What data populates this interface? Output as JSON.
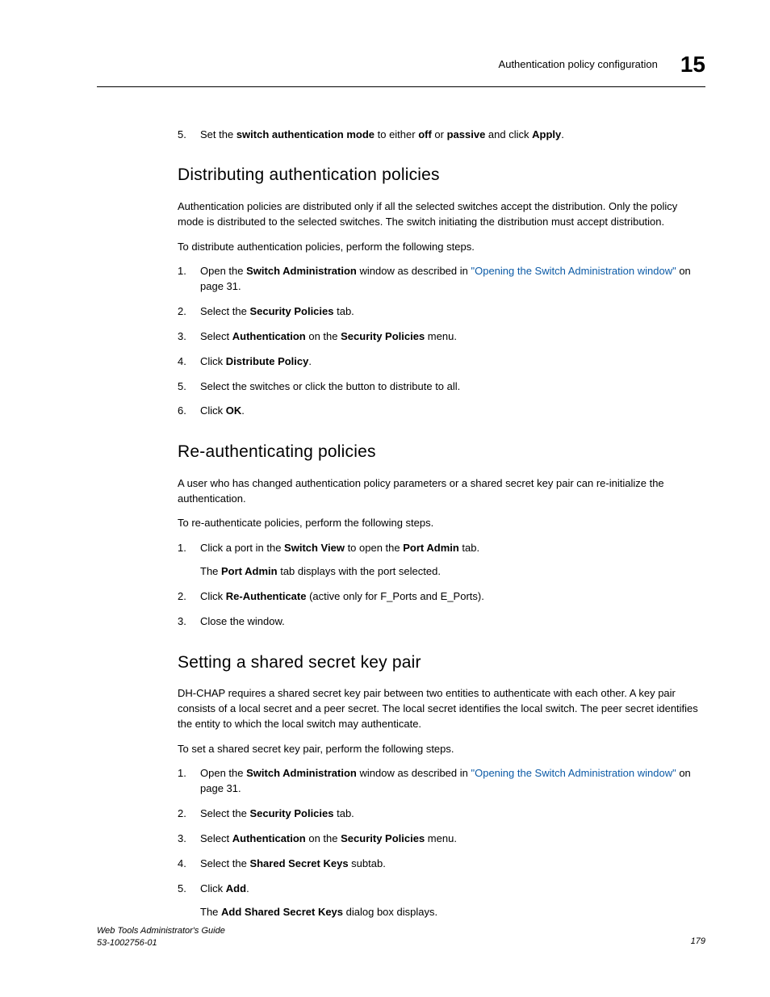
{
  "header": {
    "title": "Authentication policy configuration",
    "chapter": "15"
  },
  "top_step": {
    "num": "5",
    "prefix": "Set the ",
    "b1": "switch authentication mode",
    "mid1": " to either ",
    "b2": "off",
    "mid2": " or ",
    "b3": "passive",
    "mid3": " and click ",
    "b4": "Apply",
    "suffix": "."
  },
  "s1": {
    "heading": "Distributing authentication policies",
    "p1": "Authentication policies are distributed only if all the selected switches accept the distribution. Only the policy mode is distributed to the selected switches. The switch initiating the distribution must accept distribution.",
    "p2": "To distribute authentication policies, perform the following steps.",
    "li1": {
      "num": "1",
      "prefix": "Open the ",
      "b": "Switch Administration",
      "mid": " window as described in ",
      "link": "\"Opening the Switch Administration window\"",
      "suffix": " on page 31."
    },
    "li2": {
      "num": "2",
      "prefix": "Select the ",
      "b": "Security Policies",
      "suffix": " tab."
    },
    "li3": {
      "num": "3",
      "prefix": "Select ",
      "b1": "Authentication",
      "mid": " on the ",
      "b2": "Security Policies",
      "suffix": " menu."
    },
    "li4": {
      "num": "4",
      "prefix": "Click ",
      "b": "Distribute Policy",
      "suffix": "."
    },
    "li5": {
      "num": "5",
      "text": "Select the switches or click the button to distribute to all."
    },
    "li6": {
      "num": "6",
      "prefix": "Click ",
      "b": "OK",
      "suffix": "."
    }
  },
  "s2": {
    "heading": "Re-authenticating policies",
    "p1": "A user who has changed authentication policy parameters or a shared secret key pair can re-initialize the authentication.",
    "p2": "To re-authenticate policies, perform the following steps.",
    "li1": {
      "num": "1",
      "prefix": "Click a port in the ",
      "b1": "Switch View",
      "mid": " to open the ",
      "b2": "Port Admin",
      "suffix": " tab.",
      "sub_prefix": "The ",
      "sub_b": "Port Admin",
      "sub_suffix": " tab displays with the port selected."
    },
    "li2": {
      "num": "2",
      "prefix": "Click ",
      "b": "Re-Authenticate",
      "suffix": " (active only for F_Ports and E_Ports)."
    },
    "li3": {
      "num": "3",
      "text": "Close the window."
    }
  },
  "s3": {
    "heading": "Setting a shared secret key pair",
    "p1": "DH-CHAP requires a shared secret key pair between two entities to authenticate with each other. A key pair consists of a local secret and a peer secret. The local secret identifies the local switch. The peer secret identifies the entity to which the local switch may authenticate.",
    "p2": "To set a shared secret key pair, perform the following steps.",
    "li1": {
      "num": "1",
      "prefix": "Open the ",
      "b": "Switch Administration",
      "mid": " window as described in ",
      "link": "\"Opening the Switch Administration window\"",
      "suffix": " on page 31."
    },
    "li2": {
      "num": "2",
      "prefix": "Select the ",
      "b": "Security Policies",
      "suffix": " tab."
    },
    "li3": {
      "num": "3",
      "prefix": "Select ",
      "b1": "Authentication",
      "mid": " on the ",
      "b2": "Security Policies",
      "suffix": " menu."
    },
    "li4": {
      "num": "4",
      "prefix": "Select the ",
      "b": "Shared Secret Keys",
      "suffix": " subtab."
    },
    "li5": {
      "num": "5",
      "prefix": "Click ",
      "b": "Add",
      "suffix": ".",
      "sub_prefix": "The ",
      "sub_b": "Add Shared Secret Keys",
      "sub_suffix": " dialog box displays."
    }
  },
  "footer": {
    "left1": "Web Tools Administrator's Guide",
    "left2": "53-1002756-01",
    "right": "179"
  }
}
